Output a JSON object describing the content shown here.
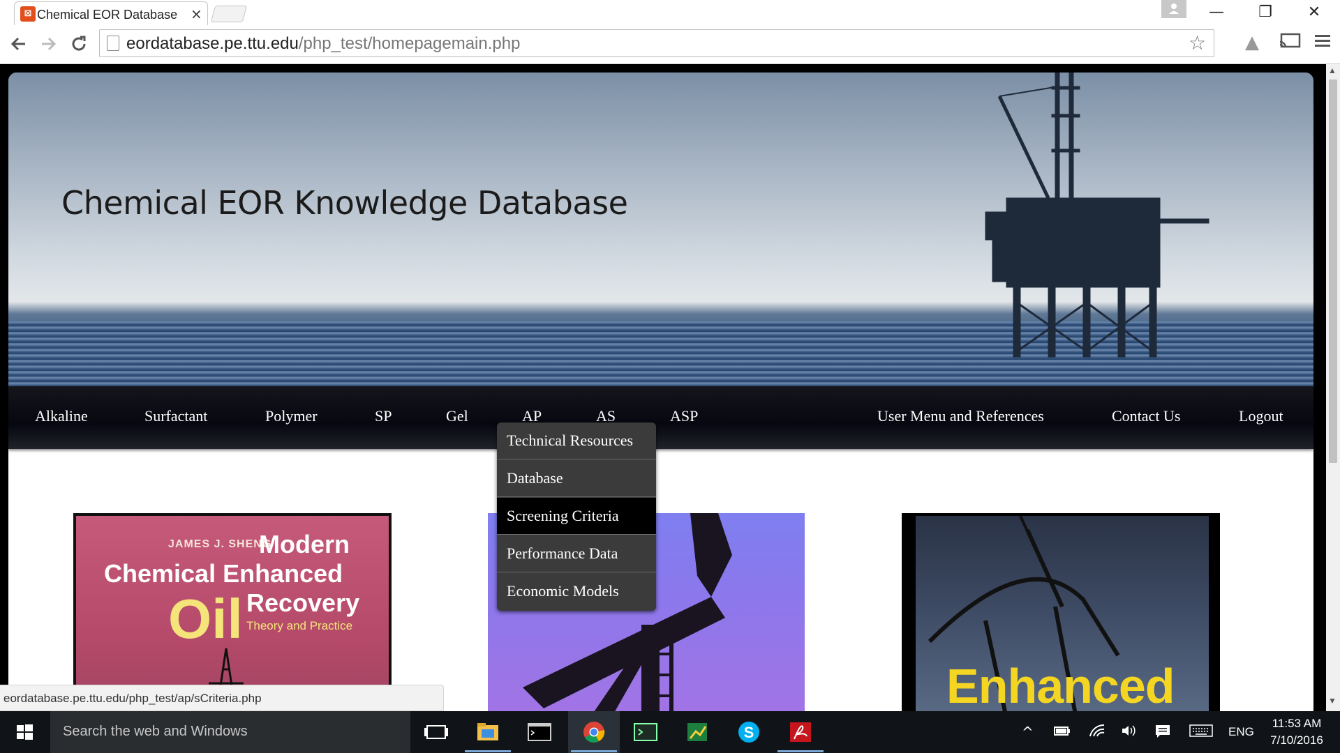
{
  "browser": {
    "tab_title": "Chemical EOR Database",
    "tab_close": "×",
    "url_host": "eordatabase.pe.ttu.edu",
    "url_path": "/php_test/homepagemain.php",
    "window_controls": {
      "minimize": "—",
      "restore": "❐",
      "close": "✕"
    }
  },
  "site": {
    "title": "Chemical EOR Knowledge Database"
  },
  "nav": {
    "left": [
      "Alkaline",
      "Surfactant",
      "Polymer",
      "SP",
      "Gel",
      "AP",
      "AS",
      "ASP"
    ],
    "right": [
      "User Menu and References",
      "Contact Us",
      "Logout"
    ]
  },
  "dropdown": {
    "parent": "AP",
    "items": [
      "Technical Resources",
      "Database",
      "Screening Criteria",
      "Performance Data",
      "Economic Models"
    ],
    "active_item": "Screening Criteria"
  },
  "books": {
    "book1": {
      "author": "JAMES J. SHENG",
      "line1": "Modern",
      "line2": "Chemical Enhanced",
      "line3a": "Oil",
      "line3b": "Recovery",
      "subtitle": "Theory and Practice"
    },
    "book2": {
      "title": "Enhanced"
    }
  },
  "status_url": "eordatabase.pe.ttu.edu/php_test/ap/sCriteria.php",
  "taskbar": {
    "search_placeholder": "Search the web and Windows",
    "language": "ENG",
    "time": "11:53 AM",
    "date": "7/10/2016"
  }
}
